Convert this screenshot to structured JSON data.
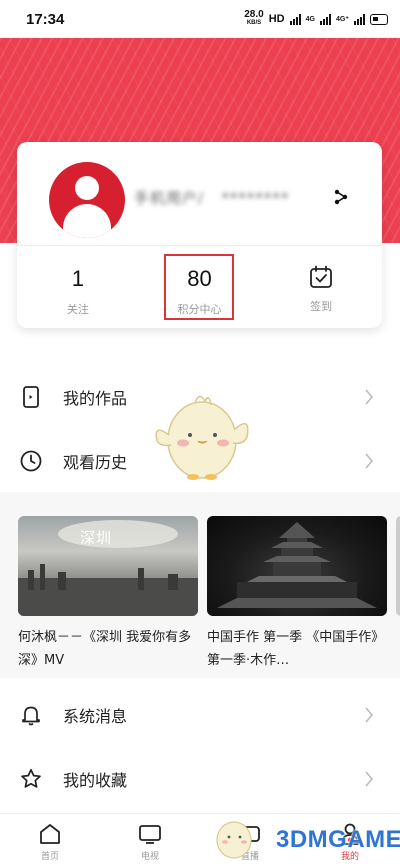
{
  "status_bar": {
    "time": "17:34",
    "net_speed_value": "28.0",
    "net_speed_unit": "KB/S",
    "hd_label": "HD",
    "signal_4g_1": "4G",
    "signal_4g_2": "4G⁺"
  },
  "profile": {
    "nickname": "手机用户/   ********",
    "stats": [
      {
        "value": "1",
        "label": "关注"
      },
      {
        "value": "80",
        "label": "积分中心"
      },
      {
        "icon": "calendar-check-icon",
        "label": "签到"
      }
    ]
  },
  "menu_top": [
    {
      "icon": "phone-icon",
      "label": "我的作品"
    },
    {
      "icon": "clock-icon",
      "label": "观看历史"
    }
  ],
  "videos": [
    {
      "thumb_text": "深圳",
      "title": "何沐枫－－《深圳 我爱你有多深》MV"
    },
    {
      "thumb_text": "",
      "title": "中国手作 第一季 《中国手作》第一季·木作…"
    }
  ],
  "menu_bottom": [
    {
      "icon": "bell-icon",
      "label": "系统消息"
    },
    {
      "icon": "star-icon",
      "label": "我的收藏"
    }
  ],
  "tabs": [
    {
      "icon": "home-icon",
      "label": "首页"
    },
    {
      "icon": "tv-icon",
      "label": "电视"
    },
    {
      "icon": "live-icon",
      "label": "直播"
    },
    {
      "icon": "profile-icon",
      "label": "我的"
    }
  ],
  "watermark": "3DMGAME",
  "colors": {
    "brand_red": "#ec3f4f",
    "highlight_border": "#d8343a",
    "watermark_blue": "#2f76d2"
  }
}
